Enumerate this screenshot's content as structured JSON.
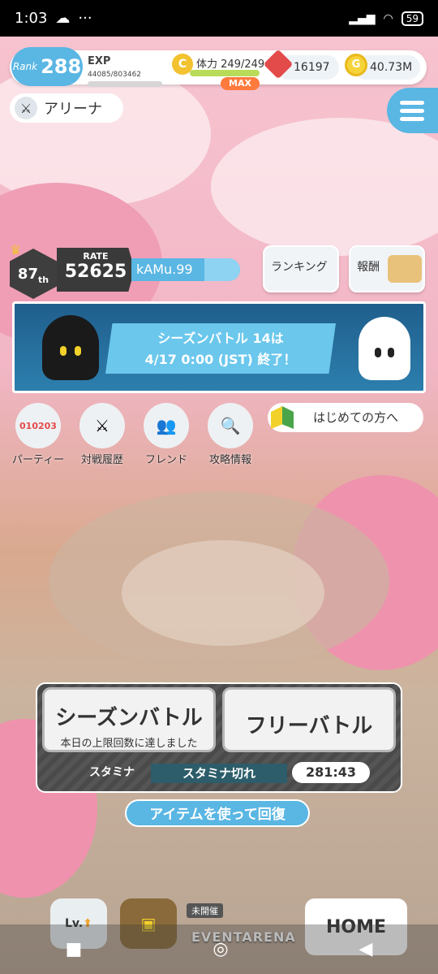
{
  "status_bar": {
    "time": "1:03",
    "battery": "59"
  },
  "header": {
    "rank_label": "Rank",
    "rank_value": "288",
    "exp_label": "EXP",
    "exp_value": "44085/803462",
    "stamina_label": "体力",
    "stamina_value": "249/249",
    "stamina_max_tag": "MAX",
    "gems": "16197",
    "coins": "40.73M"
  },
  "screen_title": "アリーナ",
  "player": {
    "placement": "87",
    "placement_suffix": "th",
    "rate_label": "RATE",
    "rate_value": "52625",
    "name": "kAMu.99"
  },
  "side_buttons": {
    "ranking": "ランキング",
    "rewards": "報酬"
  },
  "banner": {
    "line1": "シーズンバトル 14は",
    "line2": "4/17 0:00 (JST) 終了！"
  },
  "shortcuts": [
    {
      "label": "パーティー"
    },
    {
      "label": "対戦履歴"
    },
    {
      "label": "フレンド"
    },
    {
      "label": "攻略情報"
    }
  ],
  "beginner_button": "はじめての方へ",
  "battle": {
    "season_title": "シーズンバトル",
    "season_subtitle": "本日の上限回数に達しました",
    "free_title": "フリーバトル",
    "stamina_label": "スタミナ",
    "stamina_status": "スタミナ切れ",
    "timer": "281:43",
    "recover_button": "アイテムを使って回復"
  },
  "bottom_nav": {
    "level_label": "Lv.",
    "event_tag": "未開催",
    "event_name": "EVENTARENA",
    "home_label": "HOME"
  },
  "colors": {
    "accent": "#5ab6e3",
    "max_tag": "#ff7a3d",
    "gem": "#e34a4a",
    "coin": "#f6d33a"
  }
}
